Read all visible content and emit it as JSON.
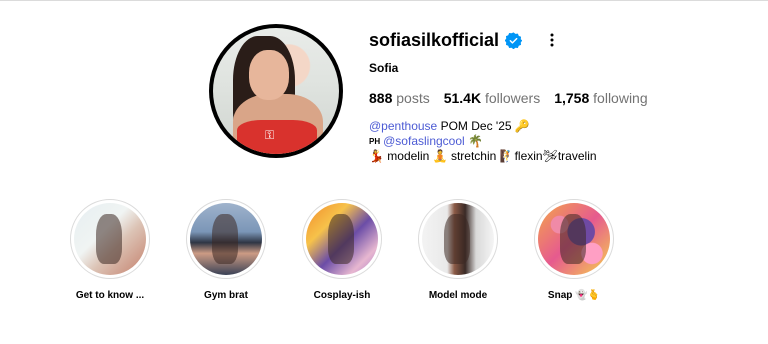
{
  "profile": {
    "username": "sofiasilkofficial",
    "full_name": "Sofia",
    "verified": true,
    "stats": [
      {
        "value": "888",
        "label": "posts"
      },
      {
        "value": "51.4K",
        "label": "followers"
      },
      {
        "value": "1,758",
        "label": "following"
      }
    ],
    "bio": {
      "line1_link": "@penthouse",
      "line1_text": " POM Dec '25 ",
      "line1_emoji": "🔑",
      "line2_prefix": "PH",
      "line2_link": "@sofaslingcool",
      "line2_emoji": "🌴",
      "line3": [
        {
          "emoji": "💃",
          "text": " modelin "
        },
        {
          "emoji": "🧘",
          "text": " stretchin "
        },
        {
          "emoji": "🧗",
          "text": "flexin"
        },
        {
          "emoji": "🛩",
          "text": "travelin"
        }
      ]
    }
  },
  "highlights": [
    {
      "label": "Get to know ..."
    },
    {
      "label": "Gym brat"
    },
    {
      "label": "Cosplay-ish"
    },
    {
      "label": "Model mode"
    },
    {
      "label": "Snap 👻🫰"
    }
  ],
  "icons": {
    "verified": "verified-badge-icon",
    "more": "more-options-icon"
  },
  "colors": {
    "link": "#4c5bd4",
    "verified": "#0095f6",
    "secondary_text": "#737373"
  }
}
